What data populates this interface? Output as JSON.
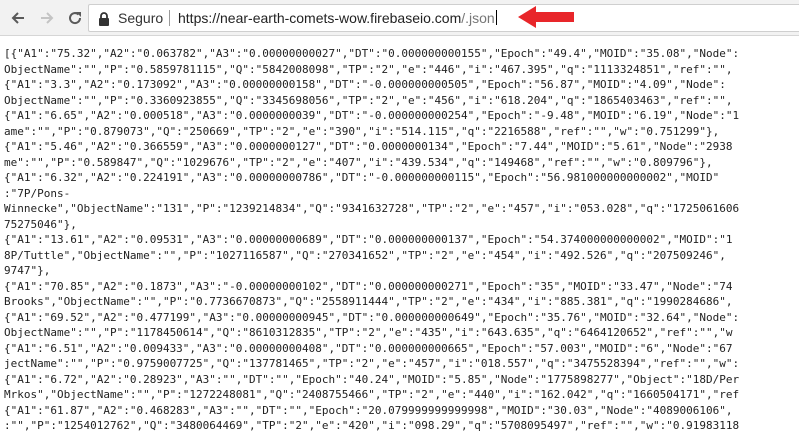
{
  "address_bar": {
    "security_label": "Seguro",
    "url_base": "https://near-earth-comets-wow.firebaseio.com",
    "url_path": "/.json"
  },
  "annotation": {
    "arrow_color": "#e8262a"
  },
  "json_text": {
    "lines": [
      "[{\"A1\":\"75.32\",\"A2\":\"0.063782\",\"A3\":\"0.00000000027\",\"DT\":\"0.000000000155\",\"Epoch\":\"49.4\",\"MOID\":\"35.08\",\"Node\":",
      "ObjectName\":\"\",\"P\":\"0.5859781115\",\"Q\":\"5842008098\",\"TP\":\"2\",\"e\":\"446\",\"i\":\"467.395\",\"q\":\"1113324851\",\"ref\":\"\",",
      "{\"A1\":\"3.3\",\"A2\":\"0.173092\",\"A3\":\"0.00000000158\",\"DT\":\"-0.000000000505\",\"Epoch\":\"56.87\",\"MOID\":\"4.09\",\"Node\":",
      "ObjectName\":\"\",\"P\":\"0.3360923855\",\"Q\":\"3345698056\",\"TP\":\"2\",\"e\":\"456\",\"i\":\"618.204\",\"q\":\"1865403463\",\"ref\":\"\",",
      "{\"A1\":\"6.65\",\"A2\":\"0.000518\",\"A3\":\"0.0000000039\",\"DT\":\"-0.000000000254\",\"Epoch\":\"-9.48\",\"MOID\":\"6.19\",\"Node\":\"1",
      "ame\":\"\",\"P\":\"0.879073\",\"Q\":\"250669\",\"TP\":\"2\",\"e\":\"390\",\"i\":\"514.115\",\"q\":\"2216588\",\"ref\":\"\",\"w\":\"0.751299\"},",
      "{\"A1\":\"5.46\",\"A2\":\"0.366559\",\"A3\":\"0.0000000127\",\"DT\":\"0.0000000134\",\"Epoch\":\"7.44\",\"MOID\":\"5.61\",\"Node\":\"2938",
      "me\":\"\",\"P\":\"0.589847\",\"Q\":\"1029676\",\"TP\":\"2\",\"e\":\"407\",\"i\":\"439.534\",\"q\":\"149468\",\"ref\":\"\",\"w\":\"0.809796\"},",
      "{\"A1\":\"6.32\",\"A2\":\"0.224191\",\"A3\":\"0.00000000786\",\"DT\":\"-0.000000000115\",\"Epoch\":\"56.981000000000002\",\"MOID\"",
      ":\"7P/Pons-",
      "Winnecke\",\"ObjectName\":\"131\",\"P\":\"1239214834\",\"Q\":\"9341632728\",\"TP\":\"2\",\"e\":\"457\",\"i\":\"053.028\",\"q\":\"1725061606",
      "75275046\"},",
      "{\"A1\":\"13.61\",\"A2\":\"0.09531\",\"A3\":\"0.00000000689\",\"DT\":\"0.000000000137\",\"Epoch\":\"54.374000000000002\",\"MOID\":\"1",
      "8P/Tuttle\",\"ObjectName\":\"\",\"P\":\"1027116587\",\"Q\":\"270341652\",\"TP\":\"2\",\"e\":\"454\",\"i\":\"492.526\",\"q\":\"207509246\",",
      "9747\"},",
      "{\"A1\":\"70.85\",\"A2\":\"0.1873\",\"A3\":\"-0.00000000102\",\"DT\":\"0.000000000271\",\"Epoch\":\"35\",\"MOID\":\"33.47\",\"Node\":\"74",
      "Brooks\",\"ObjectName\":\"\",\"P\":\"0.7736670873\",\"Q\":\"2558911444\",\"TP\":\"2\",\"e\":\"434\",\"i\":\"885.381\",\"q\":\"1990284686\",",
      "{\"A1\":\"69.52\",\"A2\":\"0.477199\",\"A3\":\"0.00000000945\",\"DT\":\"0.000000000649\",\"Epoch\":\"35.76\",\"MOID\":\"32.64\",\"Node\":",
      "ObjectName\":\"\",\"P\":\"1178450614\",\"Q\":\"8610312835\",\"TP\":\"2\",\"e\":\"435\",\"i\":\"643.635\",\"q\":\"6464120652\",\"ref\":\"\",\"w",
      "{\"A1\":\"6.51\",\"A2\":\"0.009433\",\"A3\":\"0.00000000408\",\"DT\":\"0.000000000665\",\"Epoch\":\"57.003\",\"MOID\":\"6\",\"Node\":\"67",
      "jectName\":\"\",\"P\":\"0.9759007725\",\"Q\":\"137781465\",\"TP\":\"2\",\"e\":\"457\",\"i\":\"018.557\",\"q\":\"3475528394\",\"ref\":\"\",\"w\":",
      "{\"A1\":\"6.72\",\"A2\":\"0.28923\",\"A3\":\"\",\"DT\":\"\",\"Epoch\":\"40.24\",\"MOID\":\"5.85\",\"Node\":\"1775898277\",\"Object\":\"18D/Per",
      "Mrkos\",\"ObjectName\":\"\",\"P\":\"1272248081\",\"Q\":\"2408755466\",\"TP\":\"2\",\"e\":\"440\",\"i\":\"162.042\",\"q\":\"1660504171\",\"ref",
      "{\"A1\":\"61.87\",\"A2\":\"0.468283\",\"A3\":\"\",\"DT\":\"\",\"Epoch\":\"20.079999999999998\",\"MOID\":\"30.03\",\"Node\":\"4089006106\",",
      ":\"\",\"P\":\"1254012762\",\"Q\":\"3480064469\",\"TP\":\"2\",\"e\":\"420\",\"i\":\"098.29\",\"q\":\"5708095497\",\"ref\":\"\",\"w\":\"0.91983118",
      "{\"A1\":\"6.59\",\"A2\":\"0.035395\",\"A3\":\"0.00000000335\",\"DT\":\"0.000000000429\",\"Epoch\":\"56.497999999999998\",\"MOID\":"
    ]
  }
}
